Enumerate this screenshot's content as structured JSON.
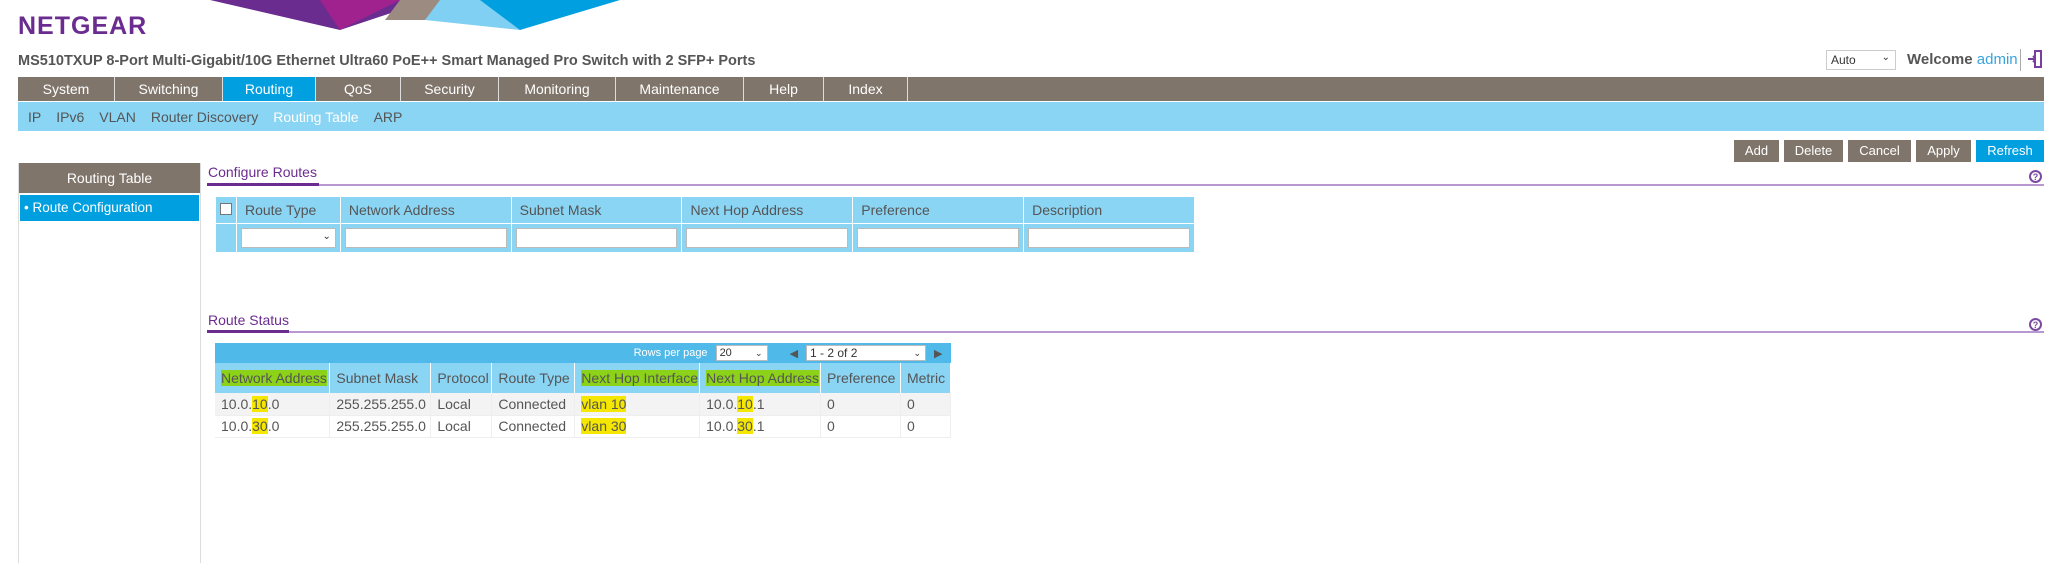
{
  "brand": {
    "logo": "NETGEAR",
    "colors": {
      "purple": "#6b2c8f",
      "blue": "#009fe0",
      "brown": "#7f756b",
      "light_blue": "#8ad4f4"
    }
  },
  "header": {
    "title": "MS510TXUP 8-Port Multi-Gigabit/10G Ethernet Ultra60 PoE++ Smart Managed Pro Switch with 2 SFP+ Ports",
    "lang_select": "Auto",
    "welcome": "Welcome",
    "user": "admin",
    "logout_icon": "logout-icon"
  },
  "nav": {
    "items": [
      {
        "label": "System"
      },
      {
        "label": "Switching"
      },
      {
        "label": "Routing",
        "active": true
      },
      {
        "label": "QoS"
      },
      {
        "label": "Security"
      },
      {
        "label": "Monitoring"
      },
      {
        "label": "Maintenance"
      },
      {
        "label": "Help"
      },
      {
        "label": "Index"
      }
    ]
  },
  "subnav": {
    "items": [
      {
        "label": "IP"
      },
      {
        "label": "IPv6"
      },
      {
        "label": "VLAN"
      },
      {
        "label": "Router Discovery"
      },
      {
        "label": "Routing Table",
        "active": true
      },
      {
        "label": "ARP"
      }
    ]
  },
  "toolbar": {
    "add": "Add",
    "delete": "Delete",
    "cancel": "Cancel",
    "apply": "Apply",
    "refresh": "Refresh"
  },
  "sidebar": {
    "header": "Routing Table",
    "items": [
      {
        "label": "• Route Configuration",
        "active": true
      }
    ]
  },
  "configure": {
    "title": "Configure Routes",
    "columns": [
      "Route Type",
      "Network Address",
      "Subnet Mask",
      "Next Hop Address",
      "Preference",
      "Description"
    ],
    "route_type_value": "",
    "inputs": [
      "",
      "",
      "",
      "",
      ""
    ]
  },
  "status": {
    "title": "Route Status",
    "rows_per_page_label": "Rows per page",
    "rows_per_page": "20",
    "page_range": "1 - 2 of 2",
    "columns": [
      "Network Address",
      "Subnet Mask",
      "Protocol",
      "Route Type",
      "Next Hop Interface",
      "Next Hop Address",
      "Preference",
      "Metric"
    ],
    "rows": [
      {
        "network_pre": "10.0.",
        "network_hl": "10",
        "network_post": ".0",
        "mask": "255.255.255.0",
        "protocol": "Local",
        "type": "Connected",
        "iface": "vlan 10",
        "hop_pre": "10.0.",
        "hop_hl": "10",
        "hop_post": ".1",
        "pref": "0",
        "metric": "0"
      },
      {
        "network_pre": "10.0.",
        "network_hl": "30",
        "network_post": ".0",
        "mask": "255.255.255.0",
        "protocol": "Local",
        "type": "Connected",
        "iface": "vlan 30",
        "hop_pre": "10.0.",
        "hop_hl": "30",
        "hop_post": ".1",
        "pref": "0",
        "metric": "0"
      }
    ]
  },
  "help_icon": "?"
}
